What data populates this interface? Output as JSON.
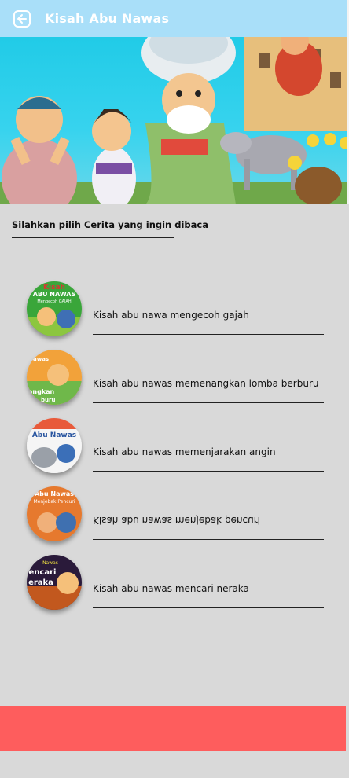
{
  "header": {
    "title": "Kisah Abu Nawas",
    "back_icon": "back-arrow-icon"
  },
  "banner": {
    "image": "abu-nawas-cartoon-illustration"
  },
  "prompt": "Silahkan pilih Cerita yang ingin dibaca",
  "stories": [
    {
      "title": "Kisah abu nawa mengecoh gajah",
      "thumb_text": [
        "Kisah",
        "ABU NAWAS",
        "Mengecoh GAJAH"
      ]
    },
    {
      "title": "Kisah abu nawas memenangkan lomba berburu",
      "thumb_text": [
        "awas",
        "angkan",
        "buru"
      ]
    },
    {
      "title": "Kisah abu nawas memenjarakan angin",
      "thumb_text": [
        "Abu Nawas"
      ]
    },
    {
      "title": "Kisah abu nawas menjebak pencuri",
      "thumb_text": [
        "Abu Nawas",
        "Menjebak Pencuri"
      ]
    },
    {
      "title": "Kisah abu nawas mencari neraka",
      "thumb_text": [
        "Nawas",
        "encari",
        "eraka"
      ]
    }
  ],
  "colors": {
    "appbar": "#a9dff9",
    "background": "#d9d9d9",
    "bottom_bar": "#fe5d5d"
  }
}
